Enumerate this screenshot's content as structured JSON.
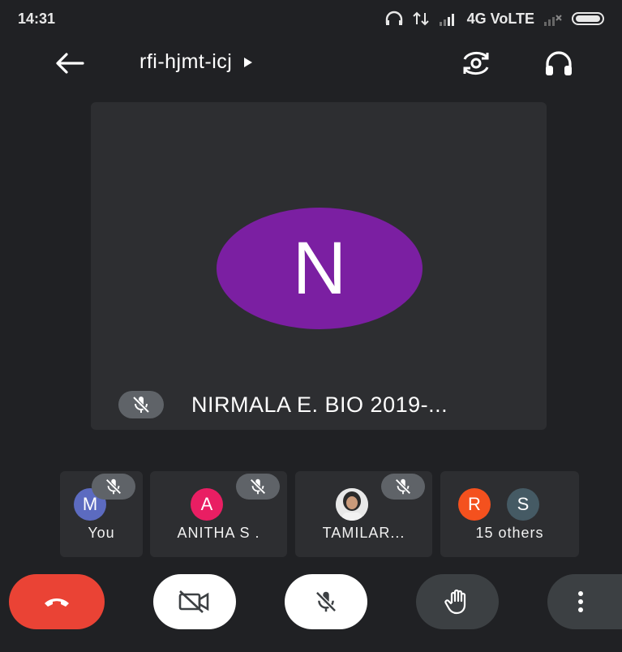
{
  "status": {
    "time": "14:31",
    "network": "4G VoLTE"
  },
  "meeting": {
    "code": "rfi-hjmt-icj"
  },
  "main": {
    "avatar_letter": "N",
    "name": "NIRMALA E. BIO 2019-..."
  },
  "participants": [
    {
      "letter": "M",
      "name": "You",
      "color": "#5c6bc0"
    },
    {
      "letter": "A",
      "name": "ANITHA S .",
      "color": "#e91e63"
    },
    {
      "name": "TAMILAR..."
    },
    {
      "letters": [
        "R",
        "S"
      ],
      "name": "15 others",
      "colors": [
        "#f4511e",
        "#455a64"
      ]
    }
  ],
  "colors": {
    "background": "#202124",
    "tile": "#2d2e31",
    "avatar_main": "#7b1fa2",
    "end_call": "#ea4335",
    "control_light": "#ffffff",
    "control_dark": "#3c4043"
  },
  "icons": [
    "back-arrow-icon",
    "play-triangle-icon",
    "camera-switch-icon",
    "headphones-icon",
    "mic-off-icon",
    "end-call-icon",
    "video-off-icon",
    "raise-hand-icon",
    "more-vert-icon"
  ]
}
